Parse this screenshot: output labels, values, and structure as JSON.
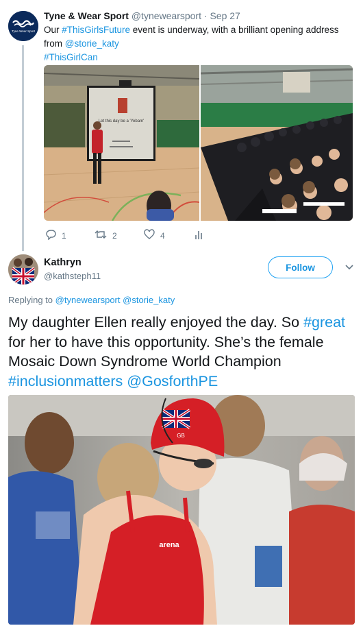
{
  "tweet1": {
    "author_name": "Tyne & Wear Sport",
    "author_handle": "@tynewearsport",
    "separator": "·",
    "date": "Sep 27",
    "avatar_logo_text": "Tyne Wear Sport",
    "text_before": "Our ",
    "hashtag1": "#ThisGirlsFuture",
    "text_middle": " event is underway, with a brilliant opening address from ",
    "mention": "@storie_katy",
    "hashtag2": "#ThisGirlCan",
    "slide_text": "Let this day be a 'Yebam'",
    "reply_count": "1",
    "retweet_count": "2",
    "like_count": "4",
    "icons": [
      "reply-icon",
      "retweet-icon",
      "like-icon",
      "analytics-icon"
    ]
  },
  "tweet2": {
    "author_name": "Kathryn",
    "author_handle": "@kathsteph11",
    "follow_label": "Follow",
    "replying_prefix": "Replying to ",
    "replying_to1": "@tynewearsport",
    "replying_to2": "@storie_katy",
    "text_part1": "My daughter Ellen really enjoyed the day. So ",
    "hashtag_great": "#great",
    "text_part2": " for her to have this opportunity. She’s the female Mosaic Down Syndrome World Champion ",
    "hashtag_inclusion": "#inclusionmatters",
    "mention_gosforth": "@GosforthPE",
    "cap_text": "GB",
    "swimsuit_brand": "arena"
  },
  "colors": {
    "link": "#1b95e0",
    "muted": "#657786",
    "follow_border": "#1da1f2",
    "text": "#14171a"
  }
}
